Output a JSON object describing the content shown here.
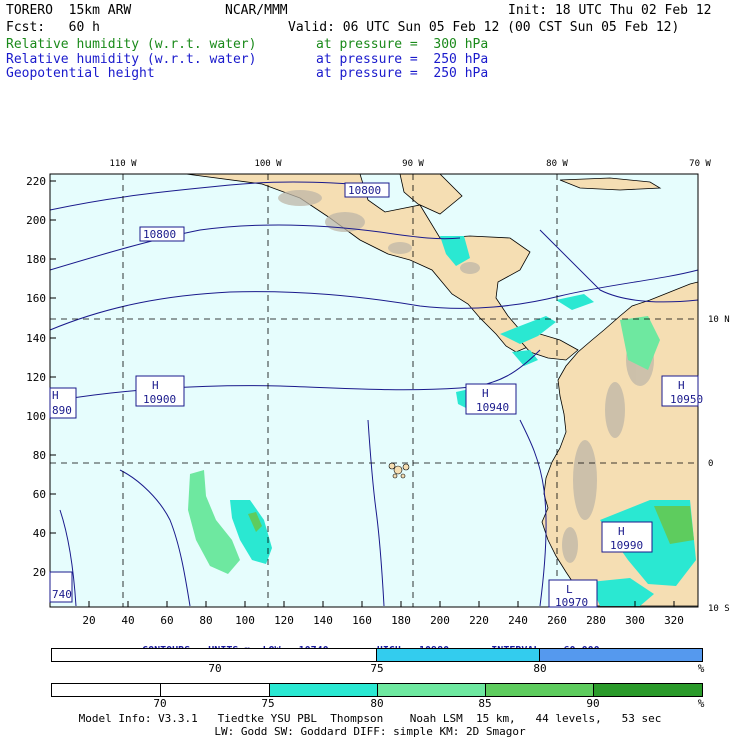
{
  "header": {
    "model": "TORERO  15km ARW",
    "center": "NCAR/MMM",
    "init": "Init: 18 UTC Thu 02 Feb 12",
    "fcst": "Fcst:   60 h",
    "valid": "Valid: 06 UTC Sun 05 Feb 12 (00 CST Sun 05 Feb 12)"
  },
  "fields": [
    {
      "name": "Relative humidity (w.r.t. water)",
      "level": "at pressure =  300 hPa",
      "color": "#1a8a1a"
    },
    {
      "name": "Relative humidity (w.r.t. water)",
      "level": "at pressure =  250 hPa",
      "color": "#1a1acc"
    },
    {
      "name": "Geopotential height",
      "level": "at pressure =  250 hPa",
      "color": "#1a1acc"
    }
  ],
  "map": {
    "lon_labels": [
      "110 W",
      "100 W",
      "90 W",
      "80 W",
      "70 W"
    ],
    "lat_labels": [
      "10 N",
      "0",
      "10 S"
    ],
    "x_ticks": [
      "20",
      "40",
      "60",
      "80",
      "100",
      "120",
      "140",
      "160",
      "180",
      "200",
      "220",
      "240",
      "260",
      "280",
      "300",
      "320"
    ],
    "y_ticks": [
      "220",
      "200",
      "180",
      "160",
      "140",
      "120",
      "100",
      "80",
      "60",
      "40",
      "20"
    ],
    "contour_labels": [
      "10800",
      "10800",
      "10900",
      "10940",
      "10990",
      "10950",
      "10970",
      "890",
      "740"
    ],
    "highs": [
      "H",
      "H",
      "H",
      "H",
      "H"
    ],
    "low": "L",
    "colors": {
      "ocean": "#e6fdfd",
      "land": "#f5deb3",
      "contour": "#1a1a8c"
    }
  },
  "contour_info": {
    "units": "CONTOURS:  UNITS=m",
    "low": "LOW=  10740.",
    "high": "HIGH=  10980.",
    "interval": "INTERVAL=   60.000"
  },
  "legend1": {
    "labels": [
      "70",
      "75",
      "80",
      "%"
    ],
    "colors": [
      "#ffffff",
      "#33ccee",
      "#5599ee"
    ]
  },
  "legend2": {
    "labels": [
      "70",
      "75",
      "80",
      "85",
      "90",
      "%"
    ],
    "colors": [
      "#ffffff",
      "#ffffff",
      "#2ae8d2",
      "#6ee8a0",
      "#5ecc5e",
      "#2a9a2a"
    ]
  },
  "footer": {
    "line1": "Model Info: V3.3.1   Tiedtke YSU PBL  Thompson    Noah LSM  15 km,   44 levels,   53 sec",
    "line2": "LW: Godd SW: Goddard DIFF: simple KM: 2D Smagor"
  }
}
